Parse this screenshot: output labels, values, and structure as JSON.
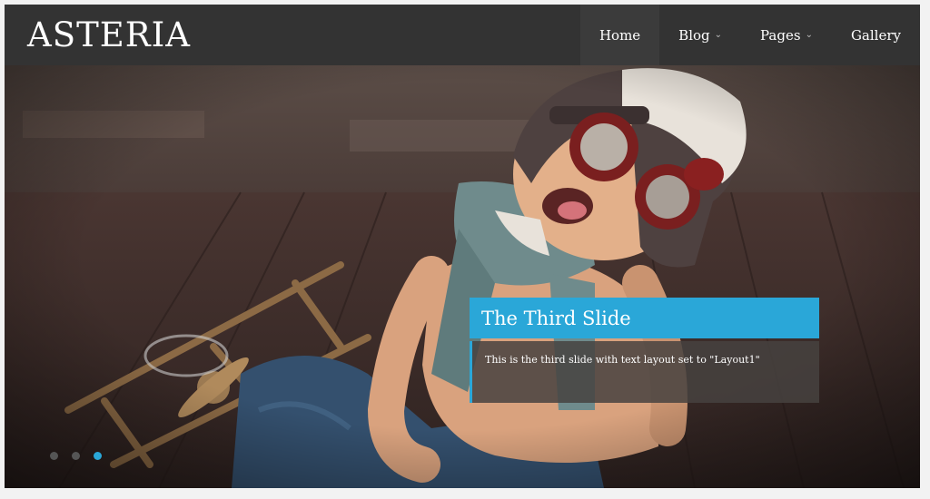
{
  "brand": {
    "name": "ASTERIA"
  },
  "nav": {
    "items": [
      {
        "label": "Home",
        "dropdown": false,
        "active": true
      },
      {
        "label": "Blog",
        "dropdown": true,
        "active": false
      },
      {
        "label": "Pages",
        "dropdown": true,
        "active": false
      },
      {
        "label": "Gallery",
        "dropdown": false,
        "active": false
      }
    ],
    "chevron_icon": "chevron-down-icon"
  },
  "slider": {
    "caption_title": "The Third Slide",
    "caption_text": "This is the third slide with text layout set to \"Layout1\"",
    "current_slide": 3,
    "total_slides": 3
  },
  "colors": {
    "accent": "#2aa7d8",
    "header_bg": "#333333",
    "page_bg": "#f2f2f2"
  }
}
